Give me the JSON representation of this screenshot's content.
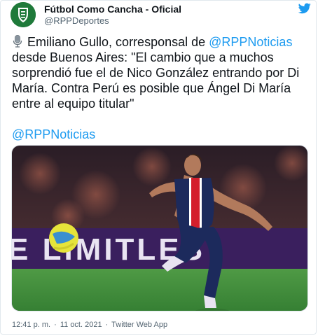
{
  "author": {
    "name": "Fútbol Como Cancha - Oficial",
    "handle": "@RPPDeportes"
  },
  "tweet": {
    "text_before_mention": "Emiliano Gullo, corresponsal de ",
    "mention": "@RPPNoticias",
    "text_after_mention": " desde Buenos Aires: \"El cambio que a muchos sorprendió fue el de Nico González entrando por Di María. Contra Perú es posible que Ángel Di María entre al equipo titular\"",
    "tag_mention": "@RPPNoticias"
  },
  "photo": {
    "banner_text": "E LIMITLES"
  },
  "meta": {
    "time": "12:41 p. m.",
    "separator": "·",
    "date": "11 oct. 2021",
    "source": "Twitter Web App"
  },
  "colors": {
    "accent": "#1d9bf0",
    "avatar_green": "#1f7a3a",
    "psg_navy": "#1c2a5c",
    "pitch_green": "#3e8c3a"
  }
}
